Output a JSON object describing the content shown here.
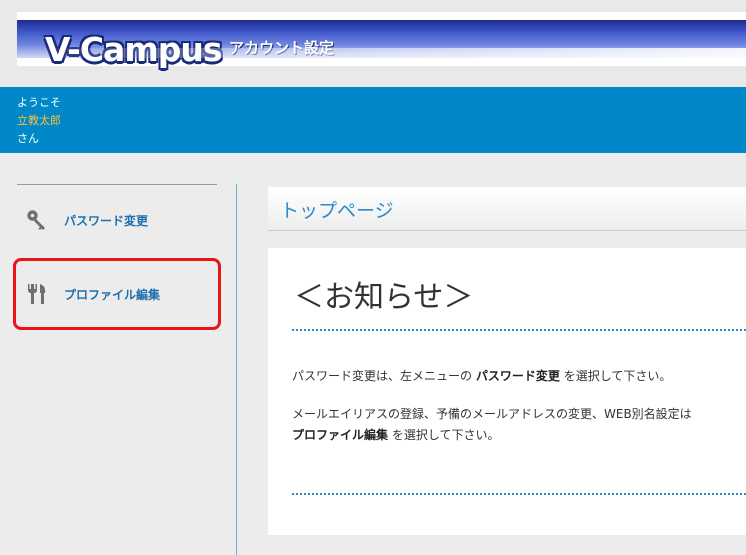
{
  "header": {
    "logo_text": "V-Campus",
    "app_title": "アカウント設定"
  },
  "welcome": {
    "greeting": "ようこそ",
    "user_name": "立教太郎",
    "honorific": "さん"
  },
  "sidebar": {
    "items": [
      {
        "label": "パスワード変更",
        "icon": "key-icon"
      },
      {
        "label": "プロファイル編集",
        "icon": "tools-icon"
      }
    ]
  },
  "main": {
    "page_title": "トップページ",
    "notice_title": "＜お知らせ＞",
    "para1": {
      "prefix": "パスワード変更は、左メニューの",
      "bold": "パスワード変更",
      "suffix": "を選択して下さい。"
    },
    "para2": {
      "line1": "メールエイリアスの登録、予備のメールアドレスの変更、WEB別名設定は",
      "bold": "プロファイル編集",
      "suffix": "を選択して下さい。"
    }
  },
  "colors": {
    "welcome_bar": "#0088c8",
    "user_name": "#ffbf3a",
    "nav_link": "#1e6fae",
    "highlight_border": "#e8141a",
    "accent": "#2a8cc8"
  }
}
